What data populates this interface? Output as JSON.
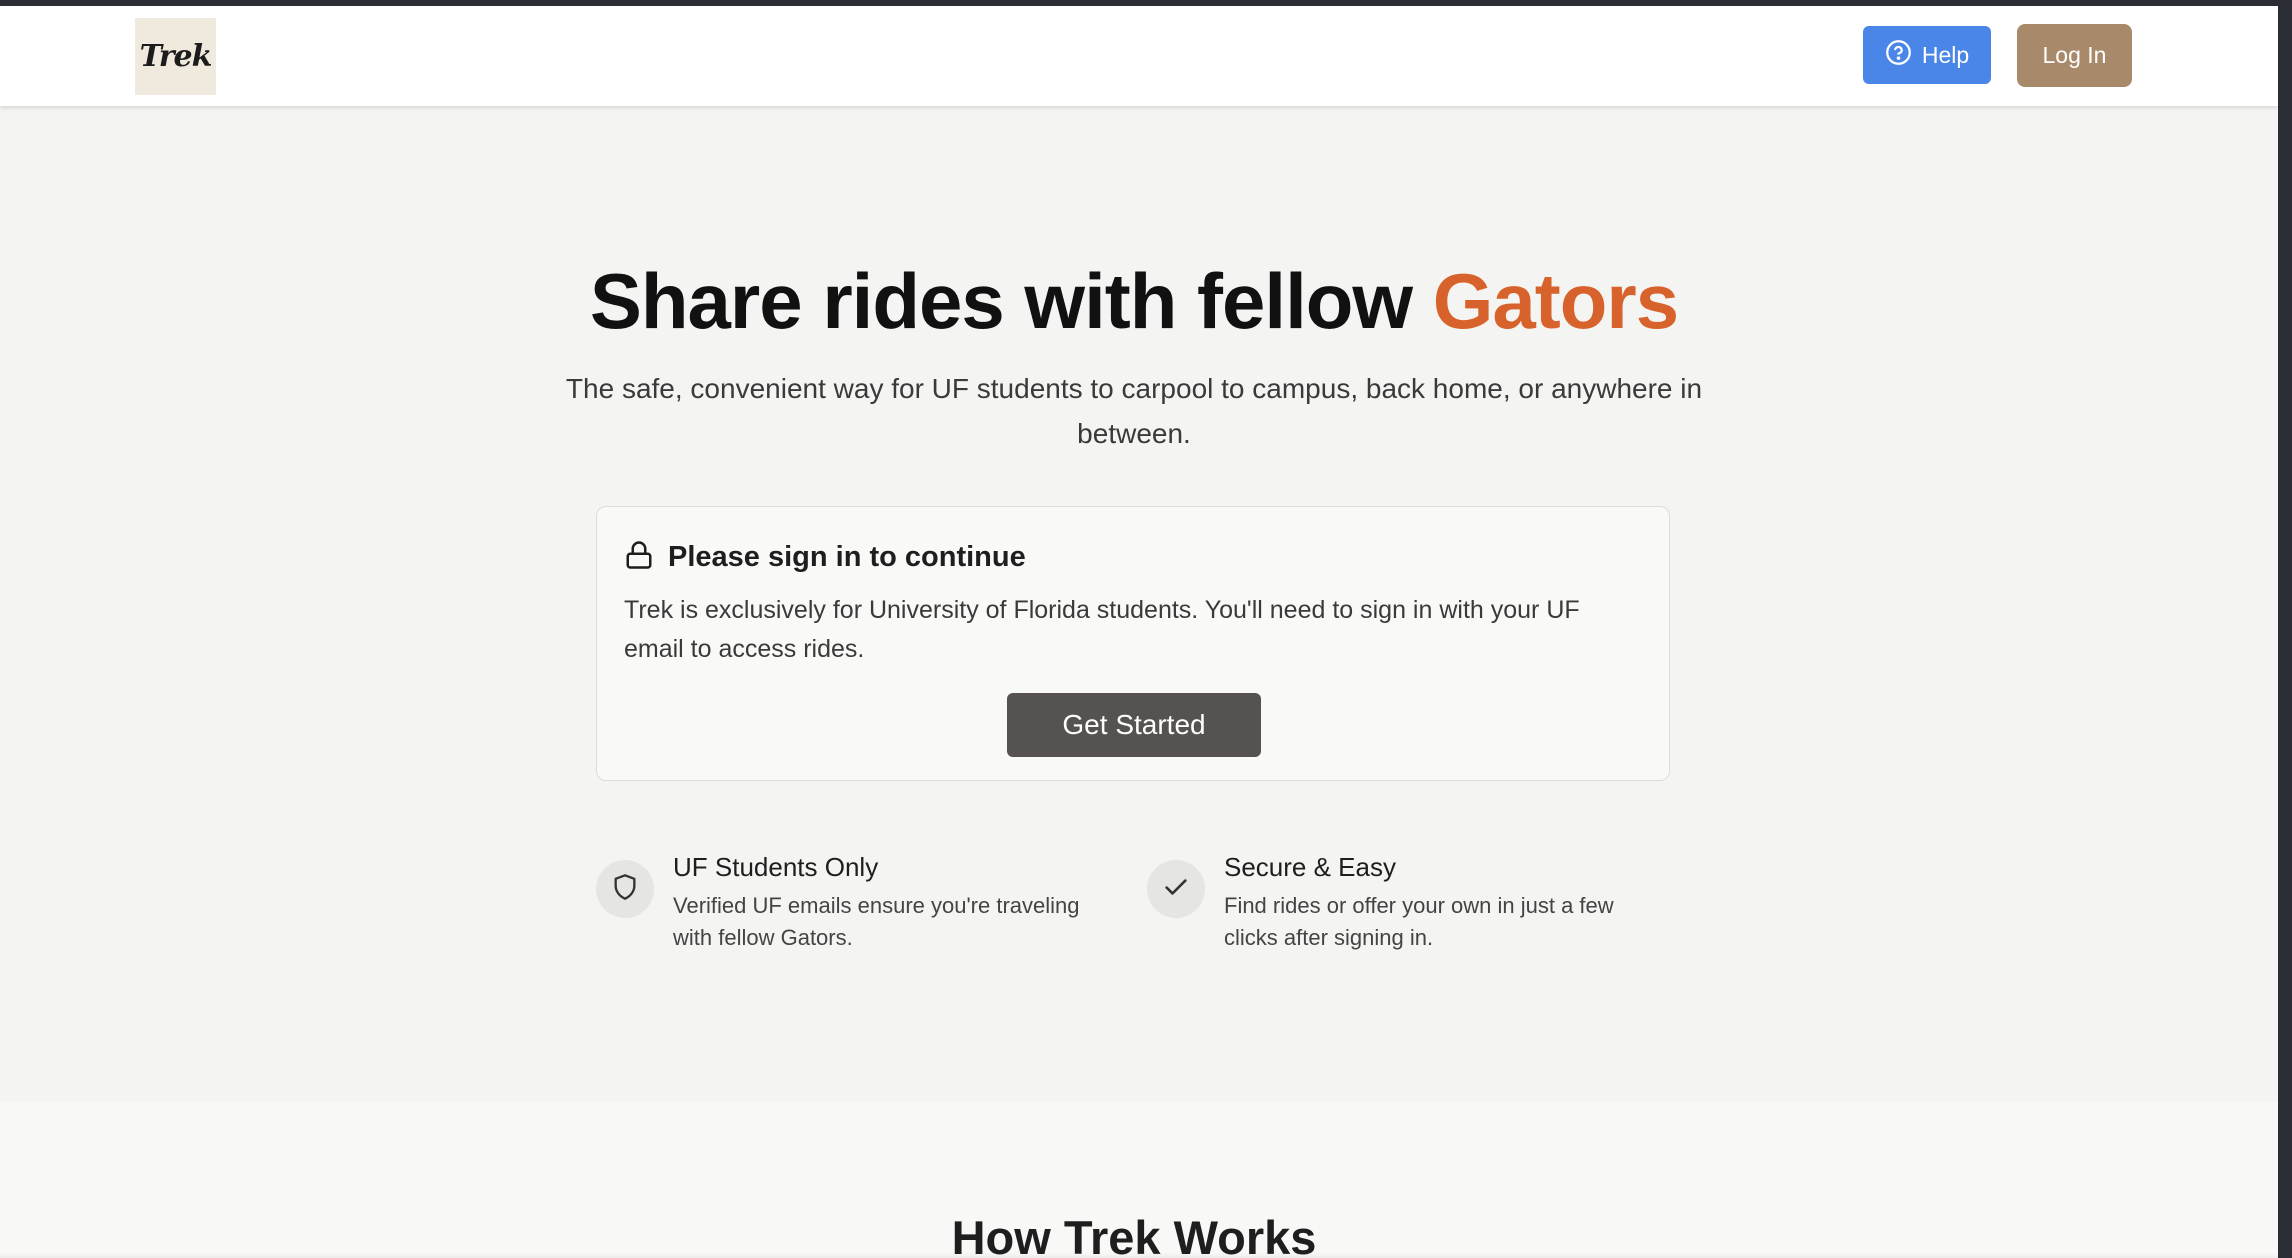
{
  "nav": {
    "logo_text": "Trek",
    "help_label": "Help",
    "help_icon": "question-circle-icon",
    "login_label": "Log In",
    "colors": {
      "help_bg": "#4a86e8",
      "login_bg": "#a88a6b"
    }
  },
  "hero": {
    "title_prefix": "Share rides with fellow ",
    "title_accent": "Gators",
    "accent_color": "#d8622b",
    "subtitle": "The safe, convenient way for UF students to carpool to campus, back home, or anywhere in between."
  },
  "signin_card": {
    "icon": "lock-icon",
    "title": "Please sign in to continue",
    "text": "Trek is exclusively for University of Florida students. You'll need to sign in with your UF email to access rides.",
    "button_label": "Get Started"
  },
  "features": [
    {
      "icon": "shield-icon",
      "title": "UF Students Only",
      "description": "Verified UF emails ensure you're traveling with fellow Gators."
    },
    {
      "icon": "check-icon",
      "title": "Secure & Easy",
      "description": "Find rides or offer your own in just a few clicks after signing in."
    }
  ],
  "how_it_works": {
    "title": "How Trek Works"
  }
}
